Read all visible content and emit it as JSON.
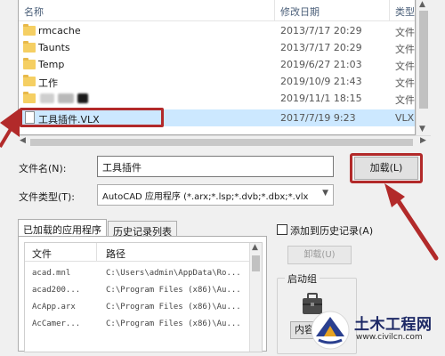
{
  "file_list": {
    "columns": {
      "name": "名称",
      "date": "修改日期",
      "type": "类型"
    },
    "rows": [
      {
        "name": "rmcache",
        "date": "2013/7/17 20:29",
        "type": "文件",
        "icon": "folder-icon"
      },
      {
        "name": "Taunts",
        "date": "2013/7/17 20:29",
        "type": "文件",
        "icon": "folder-icon"
      },
      {
        "name": "Temp",
        "date": "2019/6/27 21:03",
        "type": "文件",
        "icon": "folder-icon"
      },
      {
        "name": "工作",
        "date": "2019/10/9 21:43",
        "type": "文件",
        "icon": "folder-icon"
      },
      {
        "name": "",
        "date": "2019/11/1 18:15",
        "type": "文件",
        "icon": "folder-icon"
      },
      {
        "name": "工具插件.VLX",
        "date": "2017/7/19 9:23",
        "type": "VLX",
        "icon": "file-icon"
      }
    ],
    "selected_index": 5
  },
  "filename": {
    "label": "文件名(N):",
    "value": "工具插件"
  },
  "filetype": {
    "label": "文件类型(T):",
    "value": "AutoCAD 应用程序 (*.arx;*.lsp;*.dvb;*.dbx;*.vlx"
  },
  "load_button": {
    "label": "加载(L)"
  },
  "tabs": [
    {
      "label": "已加载的应用程序",
      "active": true
    },
    {
      "label": "历史记录列表",
      "active": false
    }
  ],
  "apps_table": {
    "columns": {
      "file": "文件",
      "path": "路径"
    },
    "rows": [
      {
        "file": "acad.mnl",
        "path": "C:\\Users\\admin\\AppData\\Ro..."
      },
      {
        "file": "acad200...",
        "path": "C:\\Program Files (x86)\\Au..."
      },
      {
        "file": "AcApp.arx",
        "path": "C:\\Program Files (x86)\\Au..."
      },
      {
        "file": "AcCamer...",
        "path": "C:\\Program Files (x86)\\Au..."
      }
    ]
  },
  "history_checkbox": {
    "label": "添加到历史记录(A)",
    "checked": false
  },
  "unload_button": {
    "label": "卸载(U)"
  },
  "startup_group": {
    "title": "启动组",
    "contents_label": "内容"
  },
  "watermark": {
    "title": "土木工程网",
    "url": "www.civilcn.com"
  },
  "colors": {
    "selection": "#cce8ff",
    "annotation": "#b22a2a",
    "folder": "#f5cf63"
  }
}
